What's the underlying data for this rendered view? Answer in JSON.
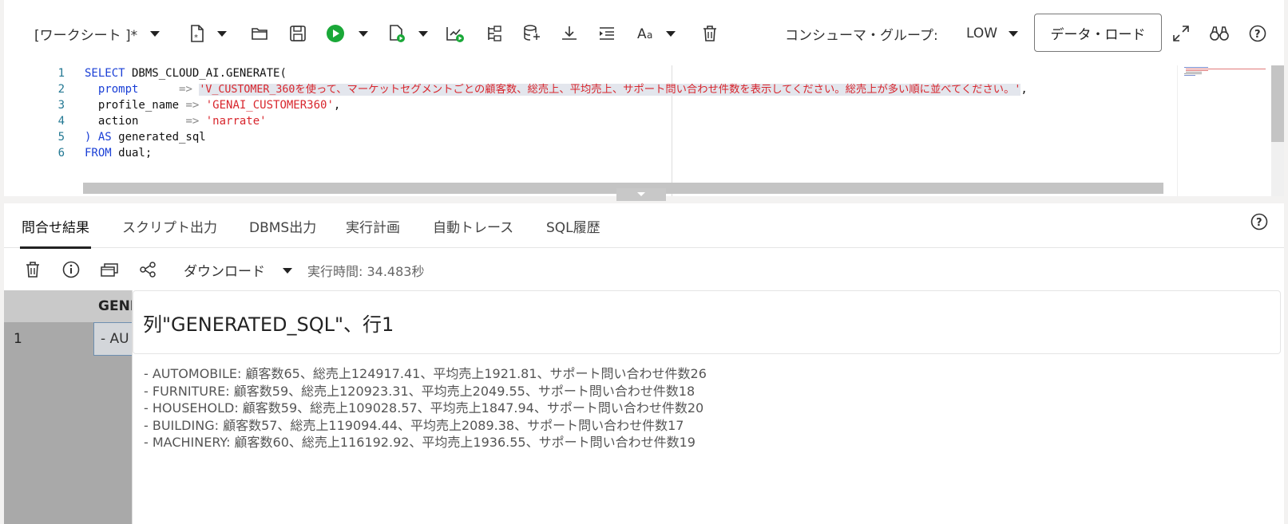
{
  "toolbar": {
    "worksheet_label": "[ワークシート ]*",
    "consumer_group_label": "コンシューマ・グループ:",
    "consumer_group_value": "LOW",
    "data_load_label": "データ・ロード"
  },
  "editor": {
    "line_numbers": [
      "1",
      "2",
      "3",
      "4",
      "5",
      "6"
    ],
    "lines": [
      {
        "kw1": "SELECT",
        "rest": " DBMS_CLOUD_AI.GENERATE("
      },
      {
        "key": "  prompt      ",
        "op": "=> ",
        "str": "'V_CUSTOMER_360を使って、マーケットセグメントごとの顧客数、総売上、平均売上、サポート問い合わせ件数を表示してください。総売上が多い順に並べてください。'",
        "tail": ","
      },
      {
        "key": "  profile_name ",
        "op": "=> ",
        "str": "'GENAI_CUSTOMER360'",
        "tail": ","
      },
      {
        "key": "  action       ",
        "op": "=> ",
        "str": "'narrate'",
        "tail": ""
      },
      {
        "kw1": ") AS",
        "rest": " generated_sql"
      },
      {
        "kw1": "FROM",
        "rest": " dual;"
      }
    ]
  },
  "results": {
    "tabs": [
      {
        "label": "問合せ結果",
        "active": true
      },
      {
        "label": "スクリプト出力",
        "active": false
      },
      {
        "label": "DBMS出力",
        "active": false
      },
      {
        "label": "実行計画",
        "active": false
      },
      {
        "label": "自動トレース",
        "active": false
      },
      {
        "label": "SQL履歴",
        "active": false
      }
    ],
    "download_label": "ダウンロード",
    "exec_time": "実行時間: 34.483秒",
    "grid": {
      "column_header": "GENE",
      "row_number": "1",
      "cell_preview": "- AU"
    },
    "popup": {
      "title": "列\"GENERATED_SQL\"、行1",
      "lines": [
        "- AUTOMOBILE: 顧客数65、総売上124917.41、平均売上1921.81、サポート問い合わせ件数26",
        "- FURNITURE: 顧客数59、総売上120923.31、平均売上2049.55、サポート問い合わせ件数18",
        "- HOUSEHOLD: 顧客数59、総売上109028.57、平均売上1847.94、サポート問い合わせ件数20",
        "- BUILDING: 顧客数57、総売上119094.44、平均売上2089.38、サポート問い合わせ件数17",
        "- MACHINERY: 顧客数60、総売上116192.92、平均売上1936.55、サポート問い合わせ件数19"
      ]
    }
  },
  "colors": {
    "keyword": "#1a3fd6",
    "string": "#d8262d",
    "run_green": "#1aa838",
    "line_number": "#237893"
  },
  "icons": [
    "new-worksheet-icon",
    "open-folder-icon",
    "save-icon",
    "run-icon",
    "run-script-icon",
    "explain-plan-icon",
    "autotrace-icon",
    "sql-tuning-icon",
    "download-icon",
    "format-icon",
    "font-case-icon",
    "trash-icon",
    "expand-icon",
    "find-icon",
    "help-icon"
  ]
}
